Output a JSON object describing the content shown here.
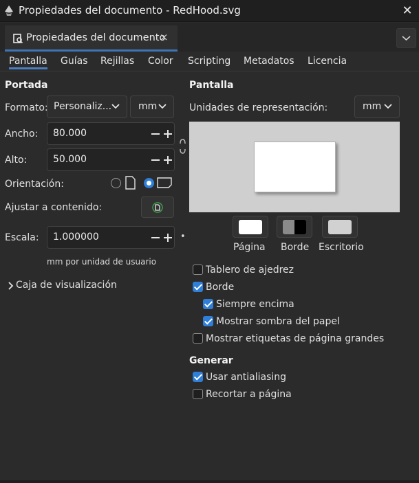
{
  "window": {
    "title": "Propiedades del documento - RedHood.svg"
  },
  "dock": {
    "tab_label": "Propiedades del documento",
    "tab_close": "×"
  },
  "tabs": [
    {
      "label": "Pantalla",
      "active": true
    },
    {
      "label": "Guías"
    },
    {
      "label": "Rejillas"
    },
    {
      "label": "Color"
    },
    {
      "label": "Scripting"
    },
    {
      "label": "Metadatos"
    },
    {
      "label": "Licencia"
    }
  ],
  "portada": {
    "title": "Portada",
    "format_label": "Formato:",
    "format_value": "Personaliz...",
    "format_unit": "mm",
    "width_label": "Ancho:",
    "width_value": "80.000",
    "height_label": "Alto:",
    "height_value": "50.000",
    "orientation_label": "Orientación:",
    "orientation_selected": "landscape",
    "fit_label": "Ajustar a contenido:",
    "scale_label": "Escala:",
    "scale_value": "1.000000",
    "scale_dot": "•",
    "scale_unit_note": "mm por unidad de usuario",
    "viewbox_label": "Caja de visualización"
  },
  "pantalla": {
    "title": "Pantalla",
    "units_label": "Unidades de representación:",
    "units_value": "mm",
    "swatches": [
      {
        "label": "Página",
        "color": "#ffffff"
      },
      {
        "label": "Borde",
        "color": "#000000"
      },
      {
        "label": "Escritorio",
        "color": "#d1d1d1"
      }
    ],
    "checks": [
      {
        "label": "Tablero de ajedrez",
        "checked": false
      },
      {
        "label": "Borde",
        "checked": true
      },
      {
        "label": "Siempre encima",
        "checked": true
      },
      {
        "label": "Mostrar sombra del papel",
        "checked": true
      },
      {
        "label": "Mostrar etiquetas de página grandes",
        "checked": false
      }
    ]
  },
  "generar": {
    "title": "Generar",
    "checks": [
      {
        "label": "Usar antialiasing",
        "checked": true
      },
      {
        "label": "Recortar a página",
        "checked": false
      }
    ]
  },
  "colors": {
    "accent": "#2f7fd8",
    "background": "#2b2b2b"
  }
}
